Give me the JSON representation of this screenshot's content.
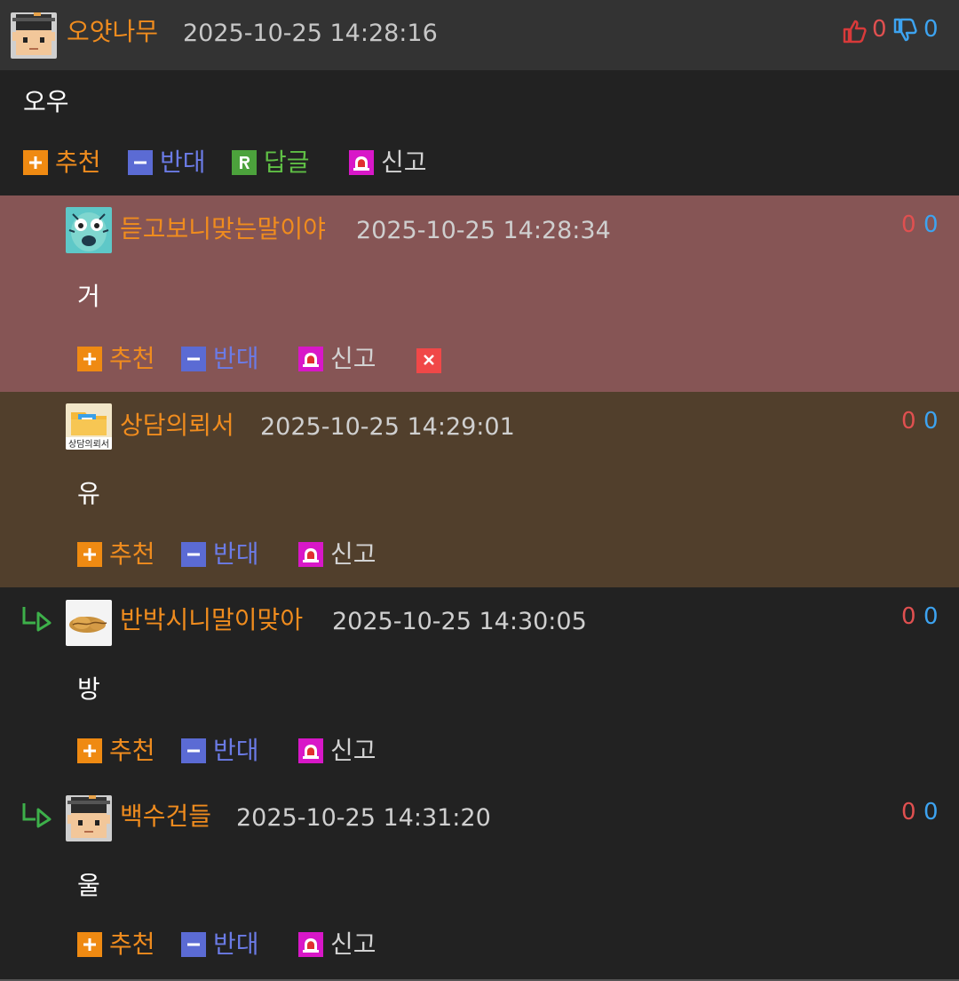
{
  "top_comment": {
    "nickname": "오얏나무",
    "date": "2025-10-25 14:28:16",
    "upvotes": "0",
    "downvotes": "0",
    "content": "오우",
    "actions": {
      "recommend": "추천",
      "oppose": "반대",
      "reply": "답글",
      "report": "신고"
    }
  },
  "replies": [
    {
      "nickname": "듣고보니맞는말이야",
      "date": "2025-10-25 14:28:34",
      "upvotes": "0",
      "downvotes": "0",
      "content": "거",
      "actions": {
        "recommend": "추천",
        "oppose": "반대",
        "report": "신고"
      }
    },
    {
      "nickname": "상담의뢰서",
      "avatar_text": "상담의뢰서",
      "date": "2025-10-25 14:29:01",
      "upvotes": "0",
      "downvotes": "0",
      "content": "유",
      "actions": {
        "recommend": "추천",
        "oppose": "반대",
        "report": "신고"
      }
    },
    {
      "nickname": "반박시니말이맞아",
      "date": "2025-10-25 14:30:05",
      "upvotes": "0",
      "downvotes": "0",
      "content": "방",
      "actions": {
        "recommend": "추천",
        "oppose": "반대",
        "report": "신고"
      }
    },
    {
      "nickname": "백수건들",
      "date": "2025-10-25 14:31:20",
      "upvotes": "0",
      "downvotes": "0",
      "content": "울",
      "actions": {
        "recommend": "추천",
        "oppose": "반대",
        "report": "신고"
      }
    }
  ],
  "colors": {
    "nickname": "#f08c1e",
    "upvote": "#e05050",
    "downvote": "#3da3f0",
    "highlight_reply_1": "#865555",
    "highlight_reply_2": "#513f2c",
    "background": "#222222"
  },
  "icons": {
    "recommend": "plus-icon",
    "oppose": "minus-icon",
    "reply": "reply-r-icon",
    "report": "siren-icon",
    "delete": "close-icon",
    "thumbs_up": "thumbs-up-icon",
    "thumbs_down": "thumbs-down-icon",
    "reply_marker": "reply-arrow-icon"
  }
}
